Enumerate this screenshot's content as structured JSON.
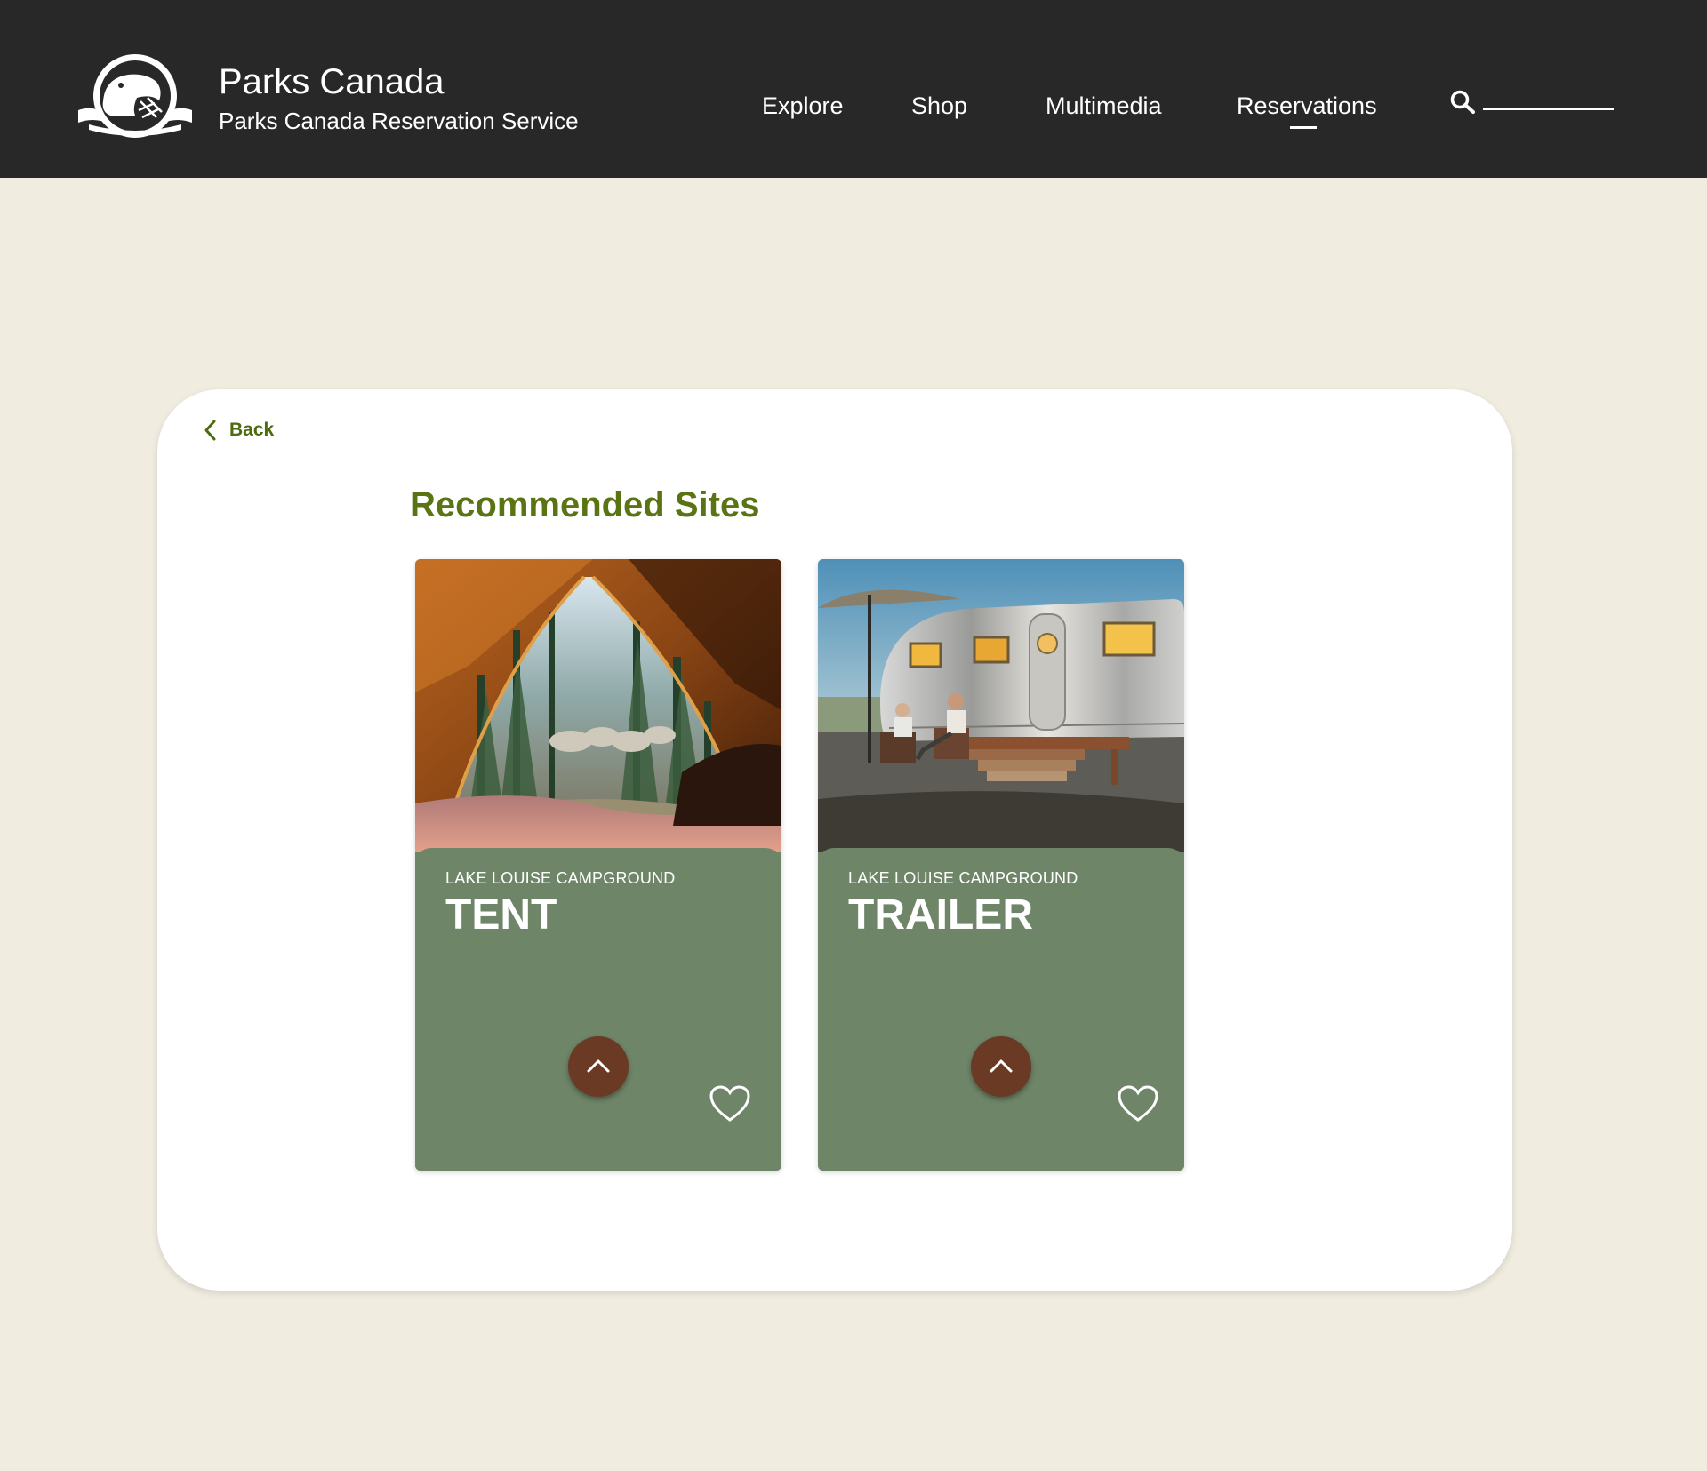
{
  "header": {
    "brand_title": "Parks Canada",
    "brand_subtitle": "Parks Canada Reservation Service",
    "nav": [
      {
        "label": "Explore"
      },
      {
        "label": "Shop"
      },
      {
        "label": "Multimedia"
      },
      {
        "label": "Reservations",
        "active": true
      }
    ],
    "search_icon": "search-icon",
    "logo_icon": "beaver-logo-icon"
  },
  "main": {
    "back_label": "Back",
    "back_icon": "chevron-left-icon",
    "section_title": "Recommended Sites",
    "cards": [
      {
        "campground": "LAKE LOUISE CAMPGROUND",
        "site_type": "TENT",
        "image": "tent-forest-view-photo",
        "expand_icon": "chevron-up-icon",
        "favorite_icon": "heart-outline-icon"
      },
      {
        "campground": "LAKE LOUISE CAMPGROUND",
        "site_type": "TRAILER",
        "image": "airstream-trailer-photo",
        "expand_icon": "chevron-up-icon",
        "favorite_icon": "heart-outline-icon"
      }
    ]
  },
  "colors": {
    "header_bg": "#282828",
    "page_bg": "#f0ece0",
    "accent_green": "#5a7414",
    "card_green": "#6e8568",
    "button_brown": "#6b3a24"
  }
}
